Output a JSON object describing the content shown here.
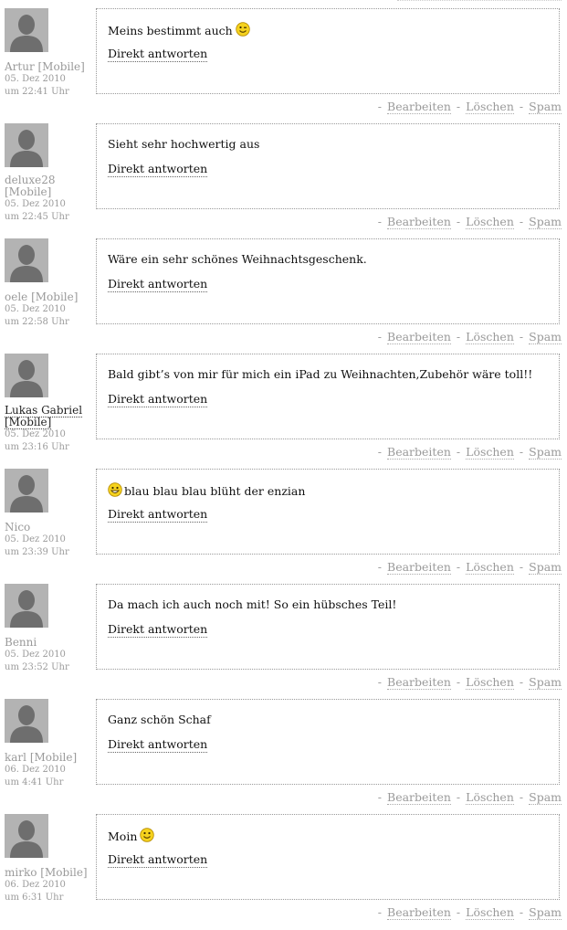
{
  "actions": {
    "edit": "Bearbeiten",
    "delete": "Löschen",
    "spam": "Spam",
    "separator": "-"
  },
  "reply_label": "Direkt antworten",
  "comments": [
    {
      "author": "Artur [Mobile]",
      "date_line1": "05. Dez 2010",
      "date_line2": "um 22:41 Uhr",
      "text": "Meins bestimmt auch",
      "smiley": "wink-smiley-icon",
      "smiley_pos": "after"
    },
    {
      "author": "deluxe28 [Mobile]",
      "date_line1": "05. Dez 2010",
      "date_line2": "um 22:45 Uhr",
      "text": "Sieht sehr hochwertig aus",
      "smiley": "",
      "smiley_pos": ""
    },
    {
      "author": "oele [Mobile]",
      "date_line1": "05. Dez 2010",
      "date_line2": "um 22:58 Uhr",
      "text": "Wäre ein sehr schönes Weihnachtsgeschenk.",
      "smiley": "",
      "smiley_pos": ""
    },
    {
      "author": "Lukas Gabriel [Mobile]",
      "date_line1": "05. Dez 2010",
      "date_line2": "um 23:16 Uhr",
      "text": "Bald gibt’s von mir für mich ein iPad zu Weihnachten,Zubehör wäre toll!!",
      "smiley": "",
      "smiley_pos": "",
      "author_linked": true
    },
    {
      "author": "Nico",
      "date_line1": "05. Dez 2010",
      "date_line2": "um 23:39 Uhr",
      "text": "blau blau blau blüht der enzian",
      "smiley": "grin-smiley-icon",
      "smiley_pos": "before"
    },
    {
      "author": "Benni",
      "date_line1": "05. Dez 2010",
      "date_line2": "um 23:52 Uhr",
      "text": "Da mach ich auch noch mit! So ein hübsches Teil!",
      "smiley": "",
      "smiley_pos": ""
    },
    {
      "author": "karl [Mobile]",
      "date_line1": "06. Dez 2010",
      "date_line2": "um 4:41 Uhr",
      "text": "Ganz schön Schaf",
      "smiley": "",
      "smiley_pos": ""
    },
    {
      "author": "mirko [Mobile]",
      "date_line1": "06. Dez 2010",
      "date_line2": "um 6:31 Uhr",
      "text": "Moin",
      "smiley": "smile-smiley-icon",
      "smiley_pos": "after"
    }
  ],
  "colors": {
    "muted": "#9a9a9a",
    "avatar_bg": "#b3b3b3",
    "avatar_fg": "#6e6e6e",
    "smiley": "#f5d21e"
  }
}
